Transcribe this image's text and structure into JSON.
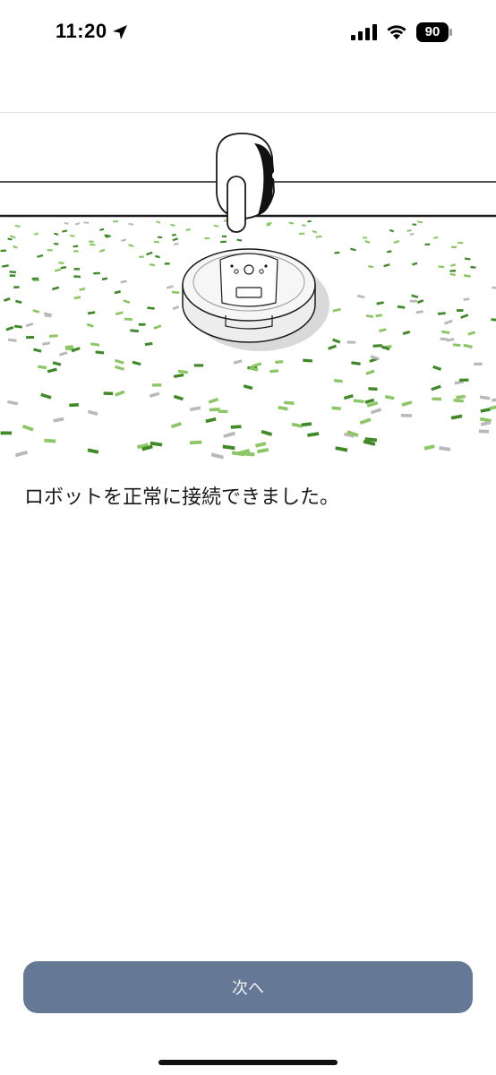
{
  "status_bar": {
    "time": "11:20",
    "location_icon": "location-arrow-icon",
    "signal_icon": "cellular-signal-icon",
    "wifi_icon": "wifi-icon",
    "battery_level": "90"
  },
  "illustration": {
    "icon": "robot-vacuum-confetti-illustration",
    "colors": {
      "confetti_dark_green": "#3f8a26",
      "confetti_light_green": "#8cc766",
      "confetti_gray": "#b9b9b9",
      "line": "#1a1a1a"
    }
  },
  "main": {
    "message": "ロボットを正常に接続できました。"
  },
  "footer": {
    "next_label": "次へ",
    "button_color": "#657896"
  }
}
